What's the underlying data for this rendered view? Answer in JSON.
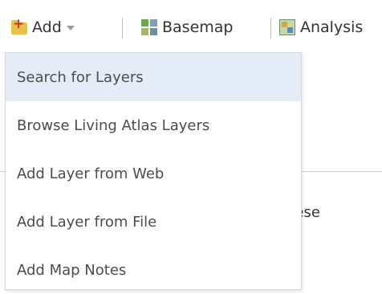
{
  "toolbar": {
    "add_label": "Add",
    "basemap_label": "Basemap",
    "analysis_label": "Analysis"
  },
  "background": {
    "text_fragment": "hese"
  },
  "add_menu": {
    "items": [
      {
        "label": "Search for Layers",
        "highlighted": true
      },
      {
        "label": "Browse Living Atlas Layers"
      },
      {
        "label": "Add Layer from Web"
      },
      {
        "label": "Add Layer from File"
      },
      {
        "label": "Add Map Notes"
      }
    ]
  },
  "colors": {
    "menu_highlight": "#e3ecf7",
    "text": "#4c4c4c"
  }
}
